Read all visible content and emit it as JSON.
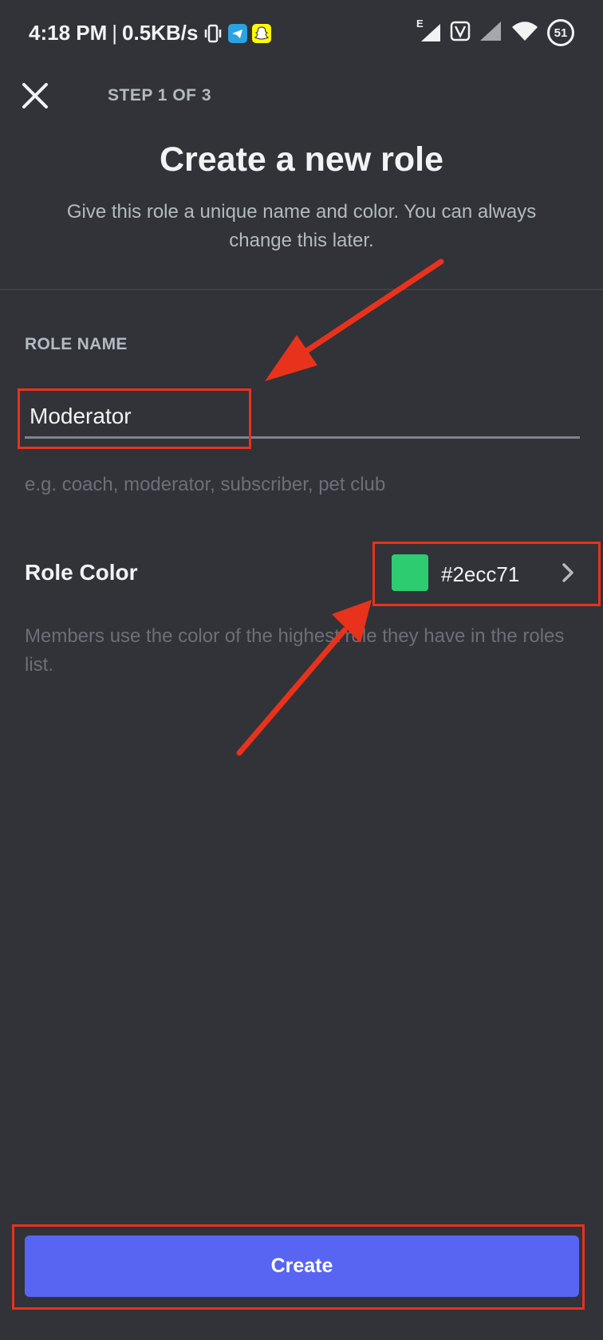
{
  "status_bar": {
    "time": "4:18 PM",
    "separator": "|",
    "net_speed": "0.5KB/s",
    "network_type": "E",
    "battery_level": "51",
    "icons": [
      "vibrate-icon",
      "telegram-icon",
      "snapchat-icon",
      "signal-icon",
      "volte-icon",
      "signal-icon-2",
      "wifi-icon",
      "battery-icon"
    ]
  },
  "header": {
    "close_icon": "close-icon",
    "step": "STEP 1 OF 3"
  },
  "title": "Create a new role",
  "subtitle": "Give this role a unique name and color. You can always change this later.",
  "role_name": {
    "label": "ROLE NAME",
    "value": "Moderator",
    "helper": "e.g. coach, moderator, subscriber, pet club"
  },
  "role_color": {
    "label": "Role Color",
    "value": "#2ecc71",
    "swatch_color": "#2ecc71",
    "helper": "Members use the color of the highest role they have in the roles list."
  },
  "footer": {
    "create_label": "Create"
  },
  "colors": {
    "background": "#313338",
    "accent": "#5865f2",
    "annotation": "#e8321c"
  }
}
